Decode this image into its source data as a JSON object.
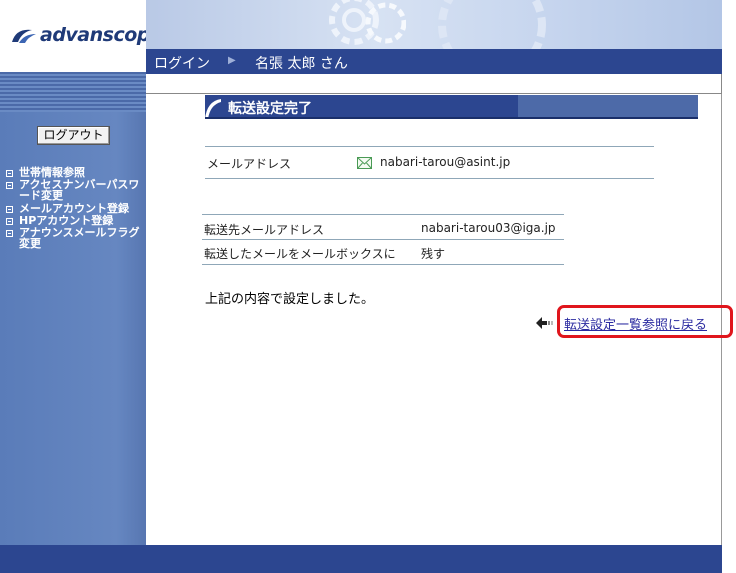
{
  "header": {
    "logo_text": "advanscope",
    "login_label": "ログイン",
    "separator": "▶",
    "user_name": "名張 太郎 さん"
  },
  "sidebar": {
    "logout_label": "ログアウト",
    "menu_items": [
      {
        "label": "世帯情報参照"
      },
      {
        "label": "アクセスナンバーパスワード変更"
      },
      {
        "label": "メールアカウント登録"
      },
      {
        "label": "HPアカウント登録"
      },
      {
        "label": "アナウンスメールフラグ変更"
      }
    ]
  },
  "main": {
    "title": "転送設定完了",
    "account": {
      "label": "メールアドレス",
      "value": "nabari-tarou@asint.jp",
      "icon": "mail-icon"
    },
    "forward": {
      "rows": [
        {
          "label": "転送先メールアドレス",
          "value": "nabari-tarou03@iga.jp"
        },
        {
          "label": "転送したメールをメールボックスに",
          "value": "残す"
        }
      ]
    },
    "result_message": "上記の内容で設定しました。",
    "back_link": "転送設定一覧参照に戻る"
  },
  "colors": {
    "nav_dark": "#2c4690",
    "sidebar": "#6687c1",
    "highlight": "#e0151c"
  }
}
